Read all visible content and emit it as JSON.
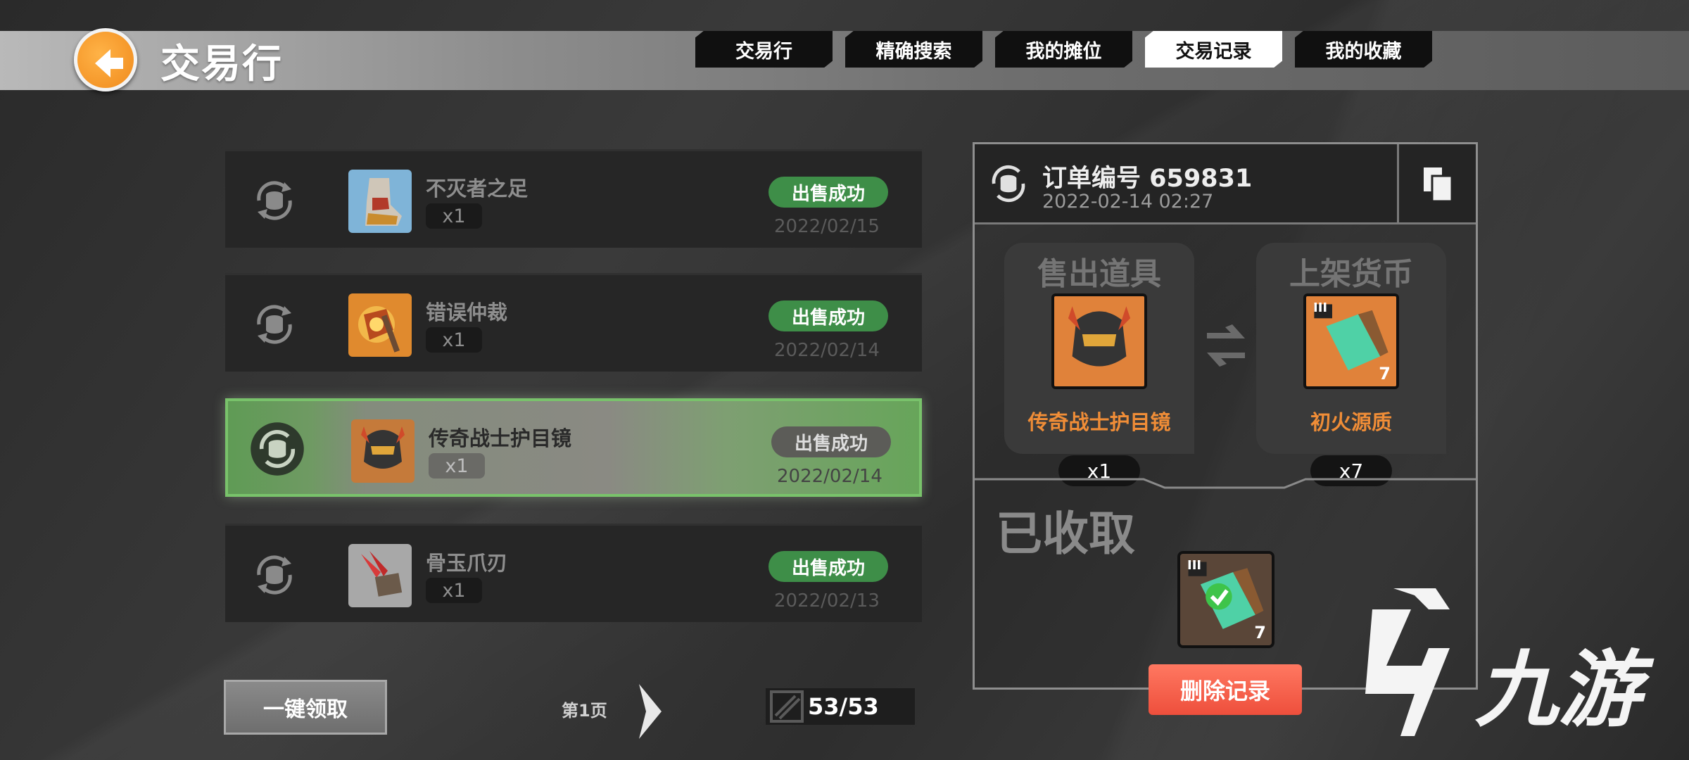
{
  "header": {
    "title": "交易行",
    "tabs": [
      {
        "label": "交易行",
        "active": false
      },
      {
        "label": "精确搜索",
        "active": false
      },
      {
        "label": "我的摊位",
        "active": false
      },
      {
        "label": "交易记录",
        "active": true
      },
      {
        "label": "我的收藏",
        "active": false
      }
    ]
  },
  "records": [
    {
      "name": "不灭者之足",
      "qty": "x1",
      "status": "出售成功",
      "date": "2022/02/15",
      "icon": "boot-armor-icon",
      "selected": false
    },
    {
      "name": "错误仲裁",
      "qty": "x1",
      "status": "出售成功",
      "date": "2022/02/14",
      "icon": "axe-weapon-icon",
      "selected": false
    },
    {
      "name": "传奇战士护目镜",
      "qty": "x1",
      "status": "出售成功",
      "date": "2022/02/14",
      "icon": "helmet-icon",
      "selected": true
    },
    {
      "name": "骨玉爪刃",
      "qty": "x1",
      "status": "出售成功",
      "date": "2022/02/13",
      "icon": "claw-blade-icon",
      "selected": false
    }
  ],
  "footer": {
    "claim_all_label": "一键领取",
    "page_label": "第1页",
    "counter": "53/53"
  },
  "order": {
    "number_label": "订单编号 659831",
    "time": "2022-02-14 02:27",
    "sold_title": "售出道具",
    "sold_item_name": "传奇战士护目镜",
    "sold_qty": "x1",
    "currency_title": "上架货币",
    "currency_item_name": "初火源质",
    "currency_qty": "x7",
    "currency_badge": "7",
    "claimed_label": "已收取",
    "claimed_badge": "7",
    "tier_mark": "III",
    "delete_label": "删除记录"
  },
  "watermark": "九游",
  "colors": {
    "accent_orange": "#f08d37",
    "status_green": "#3e8e48",
    "delete_red": "#ee4f3c",
    "back_orange": "#f08a1c"
  }
}
